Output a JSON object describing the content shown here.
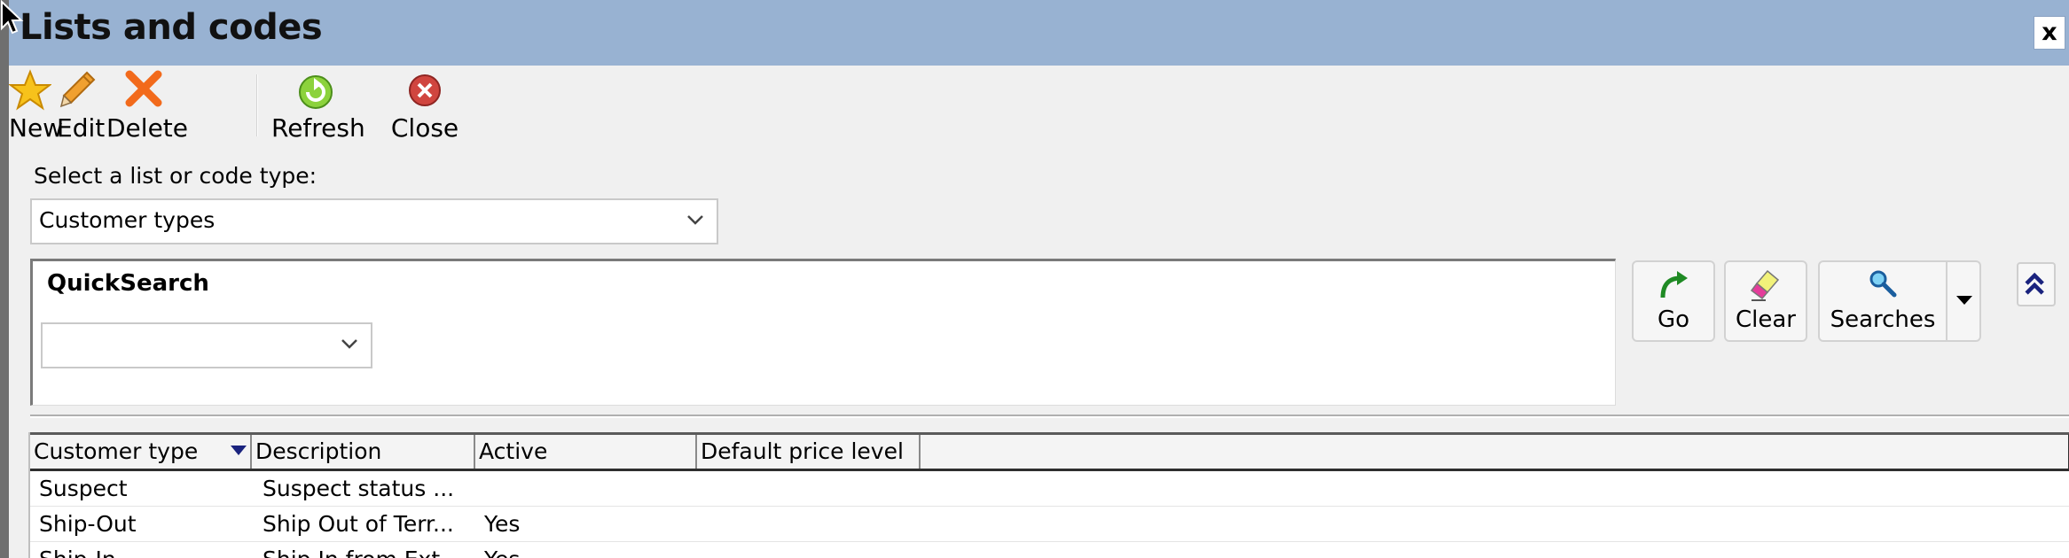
{
  "window": {
    "title": "Lists and codes",
    "close_label": "x"
  },
  "toolbar": {
    "new_label": "New",
    "edit_label": "Edit",
    "delete_label": "Delete",
    "refresh_label": "Refresh",
    "close_label": "Close"
  },
  "selector": {
    "label": "Select a list or code type:",
    "value": "Customer types"
  },
  "quicksearch": {
    "title": "QuickSearch",
    "value": ""
  },
  "search_buttons": {
    "go_label": "Go",
    "clear_label": "Clear",
    "searches_label": "Searches"
  },
  "grid": {
    "columns": [
      "Customer type",
      "Description",
      "Active",
      "Default price level"
    ],
    "sorted_column": "Customer type",
    "rows": [
      [
        "Suspect",
        "Suspect status ...",
        "",
        ""
      ],
      [
        "Ship-Out",
        "Ship Out of Terr...",
        "Yes",
        ""
      ],
      [
        "Ship-In",
        "Ship In from Ext...",
        "Yes",
        ""
      ]
    ]
  },
  "icons": {
    "new": "star-icon",
    "edit": "pencil-icon",
    "delete": "x-icon",
    "refresh": "refresh-icon",
    "close": "close-circle-icon",
    "go": "go-arrow-icon",
    "clear": "eraser-icon",
    "searches": "magnifier-icon",
    "collapse": "double-chevron-up-icon"
  },
  "colors": {
    "titlebar": "#98b2d2",
    "window_bg": "#f0f0f0",
    "sort_indicator": "#1a237e"
  }
}
